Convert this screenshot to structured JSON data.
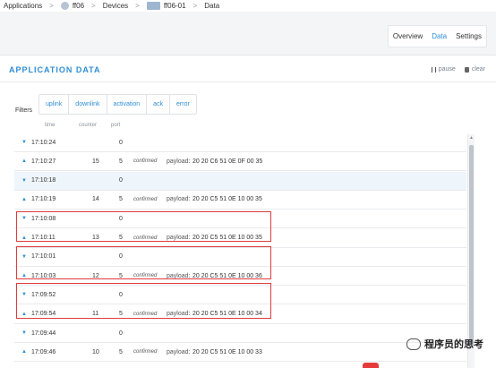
{
  "breadcrumb": {
    "applications": "Applications",
    "app": "ff06",
    "devices": "Devices",
    "device": "ff06-01",
    "data": "Data",
    "separator": ">"
  },
  "tabs": [
    {
      "label": "Overview",
      "active": false
    },
    {
      "label": "Data",
      "active": true
    },
    {
      "label": "Settings",
      "active": false
    }
  ],
  "panel": {
    "title": "APPLICATION DATA",
    "pause_label": "pause",
    "clear_label": "clear"
  },
  "filters": {
    "label": "Filters",
    "buttons": [
      "uplink",
      "downlink",
      "activation",
      "ack",
      "error"
    ]
  },
  "columns": {
    "time": "time",
    "counter": "counter",
    "port": "port"
  },
  "payload_label": "payload:",
  "rows": [
    {
      "direction": "down",
      "time": "17:10:24",
      "counter": "",
      "port": "0",
      "confirmed": "",
      "payload": ""
    },
    {
      "direction": "up",
      "time": "17:10:27",
      "counter": "15",
      "port": "5",
      "confirmed": "confirmed",
      "payload": "20 20 C6 51 0E 0F 00 35"
    },
    {
      "direction": "down",
      "time": "17:10:18",
      "counter": "",
      "port": "0",
      "confirmed": "",
      "payload": ""
    },
    {
      "direction": "up",
      "time": "17:10:19",
      "counter": "14",
      "port": "5",
      "confirmed": "confirmed",
      "payload": "20 20 C5 51 0E 10 00 35"
    },
    {
      "direction": "down",
      "time": "17:10:08",
      "counter": "",
      "port": "0",
      "confirmed": "",
      "payload": ""
    },
    {
      "direction": "up",
      "time": "17:10:11",
      "counter": "13",
      "port": "5",
      "confirmed": "confirmed",
      "payload": "20 20 C5 51 0E 10 00 35"
    },
    {
      "direction": "down",
      "time": "17:10:01",
      "counter": "",
      "port": "0",
      "confirmed": "",
      "payload": ""
    },
    {
      "direction": "up",
      "time": "17:10:03",
      "counter": "12",
      "port": "5",
      "confirmed": "confirmed",
      "payload": "20 20 C5 51 0E 10 00 36"
    },
    {
      "direction": "down",
      "time": "17:09:52",
      "counter": "",
      "port": "0",
      "confirmed": "",
      "payload": ""
    },
    {
      "direction": "up",
      "time": "17:09:54",
      "counter": "11",
      "port": "5",
      "confirmed": "confirmed",
      "payload": "20 20 C5 51 0E 10 00 34"
    },
    {
      "direction": "down",
      "time": "17:09:44",
      "counter": "",
      "port": "0",
      "confirmed": "",
      "payload": ""
    },
    {
      "direction": "up",
      "time": "17:09:46",
      "counter": "10",
      "port": "5",
      "confirmed": "confirmed",
      "payload": "20 20 C5 51 0E 10 00 33"
    }
  ],
  "watermark": "程序员的思考",
  "colors": {
    "accent": "#2f8ed6",
    "highlight": "#e03b3b",
    "row_alt": "#eef5fb"
  }
}
